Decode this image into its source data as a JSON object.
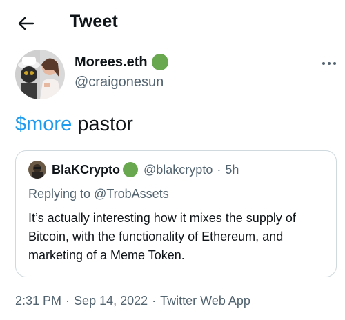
{
  "header": {
    "title": "Tweet"
  },
  "author": {
    "display_name": "Morees.eth",
    "handle": "@craigonesun",
    "badge_color": "#6aa84f"
  },
  "tweet": {
    "cashtag": "$more",
    "text": " pastor"
  },
  "quote": {
    "display_name": "BlaKCrypto",
    "badge_color": "#6aa84f",
    "handle": "@blakcrypto",
    "separator": "·",
    "time_ago": "5h",
    "replying_prefix": "Replying to ",
    "replying_to": "@TrobAssets",
    "body": "It’s actually interesting how it mixes the supply of Bitcoin, with the functionality of Ethereum, and marketing of a Meme Token."
  },
  "meta": {
    "time": "2:31 PM",
    "separator": "·",
    "date": "Sep 14, 2022",
    "source": "Twitter Web App"
  },
  "colors": {
    "accent": "#1d9bf0",
    "secondary_text": "#536471",
    "border": "#cfd9de"
  },
  "icons": {
    "back": "arrow-left-icon",
    "more": "more-horizontal-icon"
  }
}
